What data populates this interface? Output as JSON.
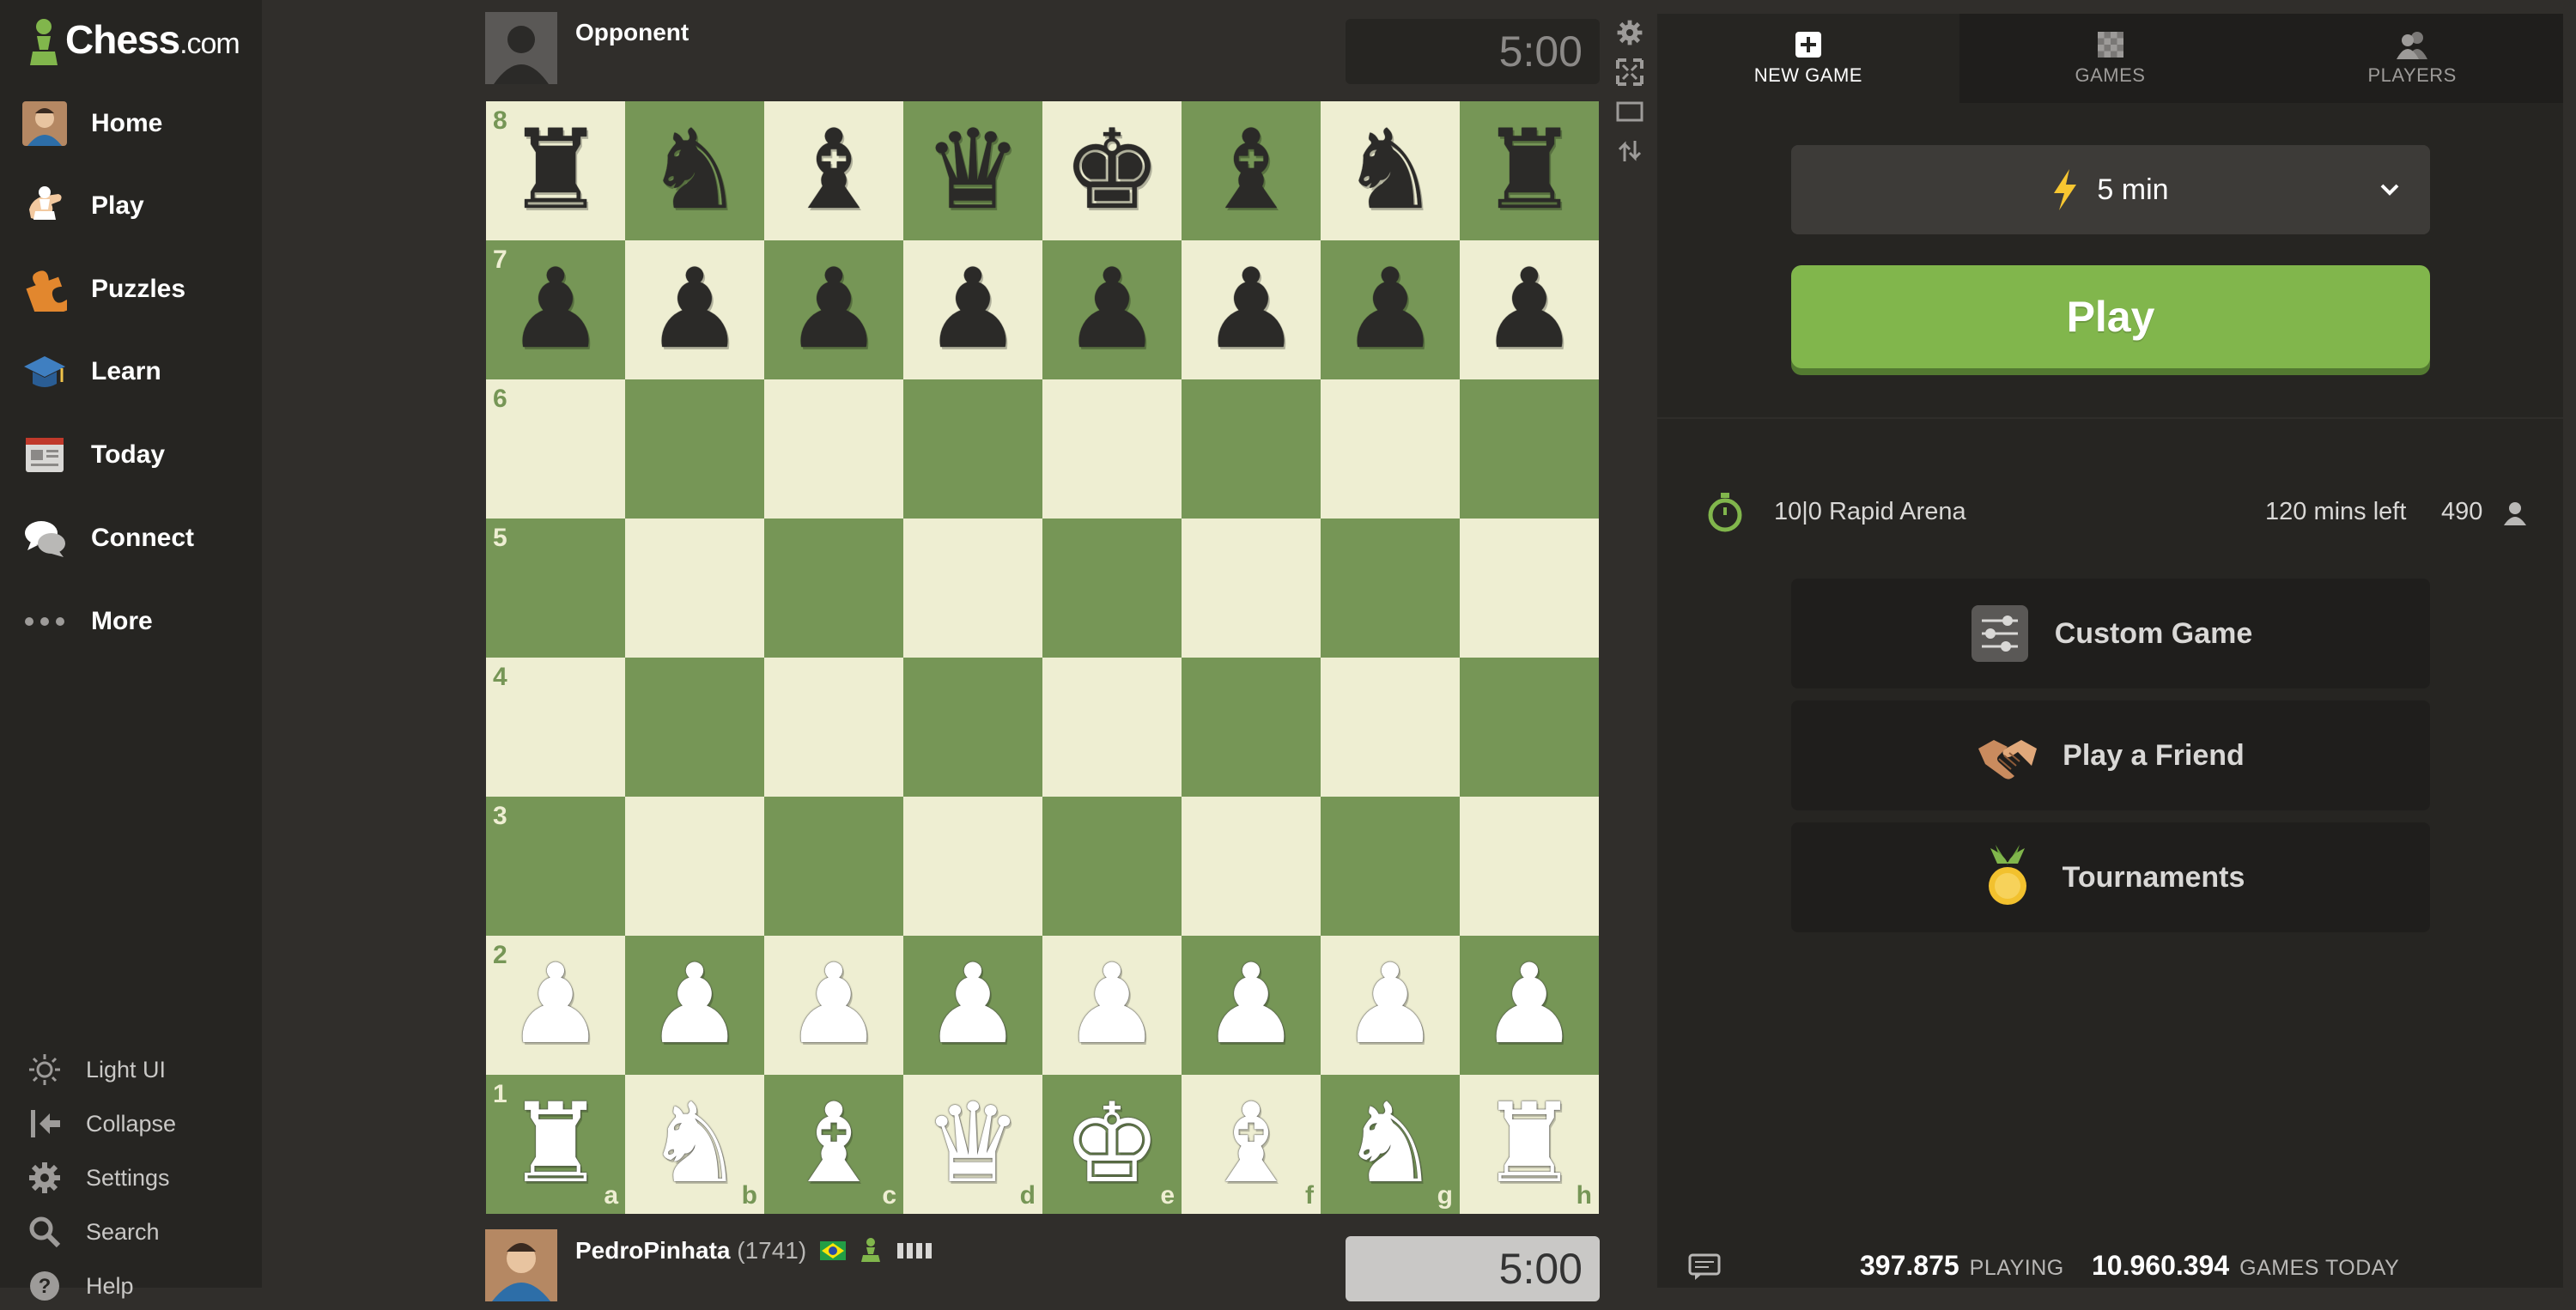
{
  "brand": {
    "name": "Chess",
    "suffix": ".com",
    "color": "#81b64c"
  },
  "sidebar": {
    "items": [
      {
        "label": "Home",
        "icon": "home-avatar-icon"
      },
      {
        "label": "Play",
        "icon": "play-hand-icon"
      },
      {
        "label": "Puzzles",
        "icon": "puzzle-piece-icon"
      },
      {
        "label": "Learn",
        "icon": "graduation-cap-icon"
      },
      {
        "label": "Today",
        "icon": "newspaper-icon"
      },
      {
        "label": "Connect",
        "icon": "chat-bubbles-icon"
      },
      {
        "label": "More",
        "icon": "more-dots-icon"
      }
    ],
    "utilities": [
      {
        "label": "Light UI",
        "icon": "sun-icon"
      },
      {
        "label": "Collapse",
        "icon": "collapse-arrow-icon"
      },
      {
        "label": "Settings",
        "icon": "gear-icon"
      },
      {
        "label": "Search",
        "icon": "search-icon"
      },
      {
        "label": "Help",
        "icon": "help-icon"
      }
    ]
  },
  "opponent": {
    "name": "Opponent",
    "clock": "5:00"
  },
  "player": {
    "name": "PedroPinhata",
    "rating": "(1741)",
    "flag": "Brazil",
    "clock": "5:00"
  },
  "board": {
    "light_color": "#eeeed2",
    "dark_color": "#769656",
    "ranks": [
      "8",
      "7",
      "6",
      "5",
      "4",
      "3",
      "2",
      "1"
    ],
    "files": [
      "a",
      "b",
      "c",
      "d",
      "e",
      "f",
      "g",
      "h"
    ],
    "position": [
      [
        "br",
        "bn",
        "bb",
        "bq",
        "bk",
        "bb",
        "bn",
        "br"
      ],
      [
        "bp",
        "bp",
        "bp",
        "bp",
        "bp",
        "bp",
        "bp",
        "bp"
      ],
      [
        "",
        "",
        "",
        "",
        "",
        "",
        "",
        ""
      ],
      [
        "",
        "",
        "",
        "",
        "",
        "",
        "",
        ""
      ],
      [
        "",
        "",
        "",
        "",
        "",
        "",
        "",
        ""
      ],
      [
        "",
        "",
        "",
        "",
        "",
        "",
        "",
        ""
      ],
      [
        "wp",
        "wp",
        "wp",
        "wp",
        "wp",
        "wp",
        "wp",
        "wp"
      ],
      [
        "wr",
        "wn",
        "wb",
        "wq",
        "wk",
        "wb",
        "wn",
        "wr"
      ]
    ]
  },
  "board_tools": [
    "gear-icon",
    "fullscreen-icon",
    "theater-mode-icon",
    "flip-board-icon"
  ],
  "tabs": [
    {
      "label": "NEW GAME",
      "icon": "plus-square-icon",
      "active": true
    },
    {
      "label": "GAMES",
      "icon": "chessboard-icon",
      "active": false
    },
    {
      "label": "PLAYERS",
      "icon": "people-icon",
      "active": false
    }
  ],
  "time_control": {
    "label": "5 min",
    "icon": "lightning-bolt-icon"
  },
  "play_button": {
    "label": "Play",
    "color": "#81b64c"
  },
  "arena": {
    "name": "10|0 Rapid Arena",
    "time_left": "120 mins left",
    "players": "490"
  },
  "options": [
    {
      "label": "Custom Game",
      "icon": "sliders-icon"
    },
    {
      "label": "Play a Friend",
      "icon": "handshake-icon"
    },
    {
      "label": "Tournaments",
      "icon": "medal-icon"
    }
  ],
  "stats": {
    "playing_count": "397.875",
    "playing_label": "PLAYING",
    "games_today_count": "10.960.394",
    "games_today_label": "GAMES TODAY"
  }
}
